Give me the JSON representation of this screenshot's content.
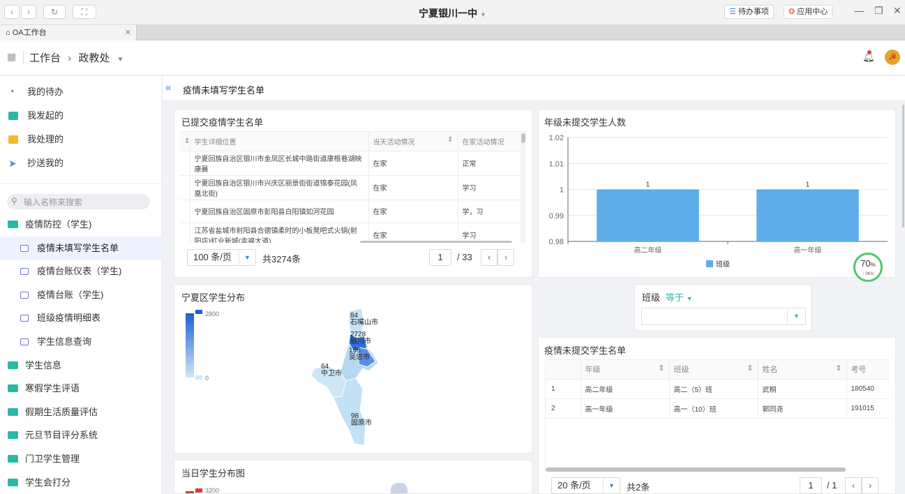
{
  "titlebar": {
    "back_icon": "chevron-left-icon",
    "forward_icon": "chevron-right-icon",
    "refresh_icon": "refresh-icon",
    "fullscreen_icon": "fullscreen-icon",
    "app_title": "宁夏银川一中",
    "todo_label": "待办事项",
    "app_center_label": "应用中心"
  },
  "tabs": [
    {
      "label": "OA工作台"
    }
  ],
  "header": {
    "grid_icon": "apps-grid-icon",
    "crumb_root": "工作台",
    "crumb_sep": "›",
    "crumb_current": "政教处",
    "bell_icon": "bell-icon",
    "avatar_icon": "party-emblem-icon"
  },
  "sidebar": {
    "quick": [
      {
        "label": "我的待办",
        "icon": "clock-icon",
        "color": "#4a7bd9"
      },
      {
        "label": "我发起的",
        "icon": "edit-icon",
        "color": "#2db7a7"
      },
      {
        "label": "我处理的",
        "icon": "task-icon",
        "color": "#f5b82e"
      },
      {
        "label": "抄送我的",
        "icon": "send-icon",
        "color": "#3d8fd6"
      }
    ],
    "search_placeholder": "输入名称来搜索",
    "menu": [
      {
        "label": "疫情防控（学生)",
        "type": "folder"
      },
      {
        "label": "疫情未填写学生名单",
        "type": "child",
        "active": true
      },
      {
        "label": "疫情台账仪表（学生)",
        "type": "child"
      },
      {
        "label": "疫情台账（学生)",
        "type": "child"
      },
      {
        "label": "班级疫情明细表",
        "type": "child"
      },
      {
        "label": "学生信息查询",
        "type": "child"
      },
      {
        "label": "学生信息",
        "type": "folder"
      },
      {
        "label": "寒假学生评语",
        "type": "folder"
      },
      {
        "label": "假期生活质量评估",
        "type": "folder"
      },
      {
        "label": "元旦节目评分系统",
        "type": "folder"
      },
      {
        "label": "门卫学生管理",
        "type": "folder"
      },
      {
        "label": "学生会打分",
        "type": "folder"
      }
    ]
  },
  "page": {
    "collapse_icon": "double-chevron-left-icon",
    "title": "疫情未填写学生名单"
  },
  "submitted": {
    "title": "已提交疫情学生名单",
    "sort_icon": "sort-icon",
    "columns": [
      "学生详细位置",
      "当天活动情况",
      "在家活动情况"
    ],
    "rows": [
      [
        "宁夏回族自治区银川市金凤区长城中路街道康根巷湖映康晨",
        "在家",
        "正常"
      ],
      [
        "宁夏回族自治区银川市兴庆区丽景街街道锦泰花园(凤凰北街)",
        "在家",
        "学习"
      ],
      [
        "宁夏回族自治区固原市彭阳县白阳镇如河花园",
        "在家",
        "学，习"
      ],
      [
        "江苏省盐城市射阳县合德镇柔时的小板凳吧式火锅(射阳店)虹业新城(幸福大道)",
        "在家",
        "学习"
      ]
    ],
    "page_size": "100 条/页",
    "total": "共3274条",
    "current_page": "1",
    "total_pages": "/ 33"
  },
  "grade_chart": {
    "title": "年级未提交学生人数",
    "legend": "班级",
    "color": "#5dade8"
  },
  "chart_data": {
    "type": "bar",
    "title": "年级未提交学生人数",
    "categories": [
      "高二年级",
      "高一年级"
    ],
    "series": [
      {
        "name": "班级",
        "values": [
          1,
          1
        ]
      }
    ],
    "ylim": [
      0.98,
      1.02
    ],
    "yticks": [
      "0.98",
      "0.99",
      "1",
      "1.01",
      "1.02"
    ],
    "data_labels": [
      "1",
      "1"
    ],
    "legend": "bottom"
  },
  "perf_badge": {
    "percent": "70",
    "unit": "%",
    "speed": "0K/s"
  },
  "map": {
    "title": "宁夏区学生分布",
    "scale_max": "2800",
    "scale_min": "0",
    "regions": [
      {
        "value": "84",
        "name": "石嘴山市"
      },
      {
        "value": "2728",
        "name": "银川市"
      },
      {
        "value": "195",
        "name": "吴忠市"
      },
      {
        "value": "64",
        "name": "中卫市"
      },
      {
        "value": "98",
        "name": "固原市"
      }
    ]
  },
  "filter": {
    "field": "班级",
    "op": "等于",
    "value": ""
  },
  "unsubmitted": {
    "title": "疫情未提交学生名单",
    "columns": [
      "",
      "年级",
      "班级",
      "姓名",
      "考号"
    ],
    "rows": [
      [
        "1",
        "高二年级",
        "高二（5）班",
        "武桐",
        "180540"
      ],
      [
        "2",
        "高一年级",
        "高一（10）班",
        "郭同尧",
        "191015"
      ]
    ],
    "page_size": "20 条/页",
    "total": "共2条",
    "current_page": "1",
    "total_pages": "/ 1"
  },
  "daily_map": {
    "title": "当日学生分布图",
    "scale_max": "3200"
  }
}
